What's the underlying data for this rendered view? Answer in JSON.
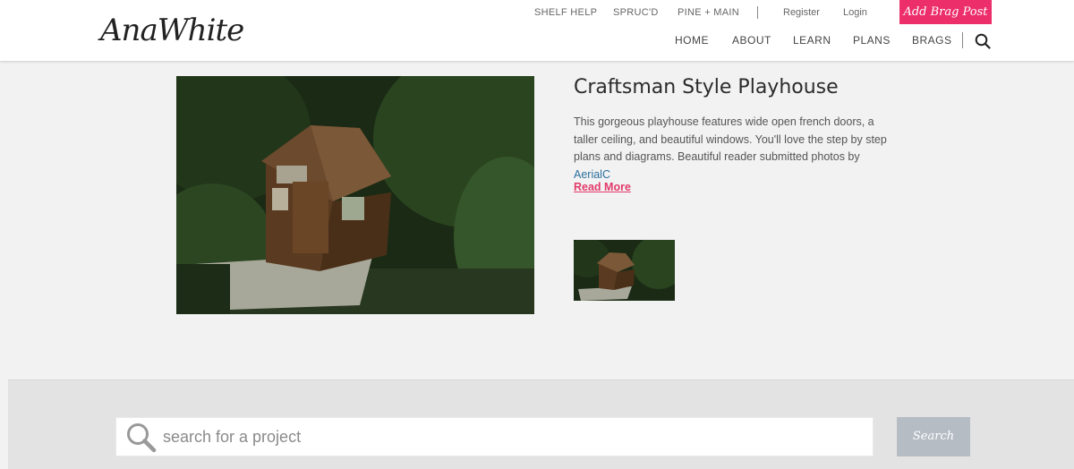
{
  "header": {
    "logo_text": "AnaWhite",
    "util_links": [
      "SHELF HELP",
      "SPRUC'D",
      "PINE + MAIN"
    ],
    "register": "Register",
    "login": "Login",
    "brag_button": "Add Brag Post",
    "main_nav": [
      "HOME",
      "ABOUT",
      "LEARN",
      "PLANS",
      "BRAGS"
    ],
    "search_icon": "search-icon"
  },
  "feature": {
    "title": "Craftsman Style Playhouse",
    "description": "This gorgeous playhouse features wide open french doors, a taller ceiling, and beautiful windows.  You'll love the step by step plans and diagrams.  Beautiful reader submitted photos by ",
    "credit_link": "AerialC",
    "read_more": "Read More"
  },
  "search": {
    "placeholder": "search for a project",
    "button": "Search"
  }
}
